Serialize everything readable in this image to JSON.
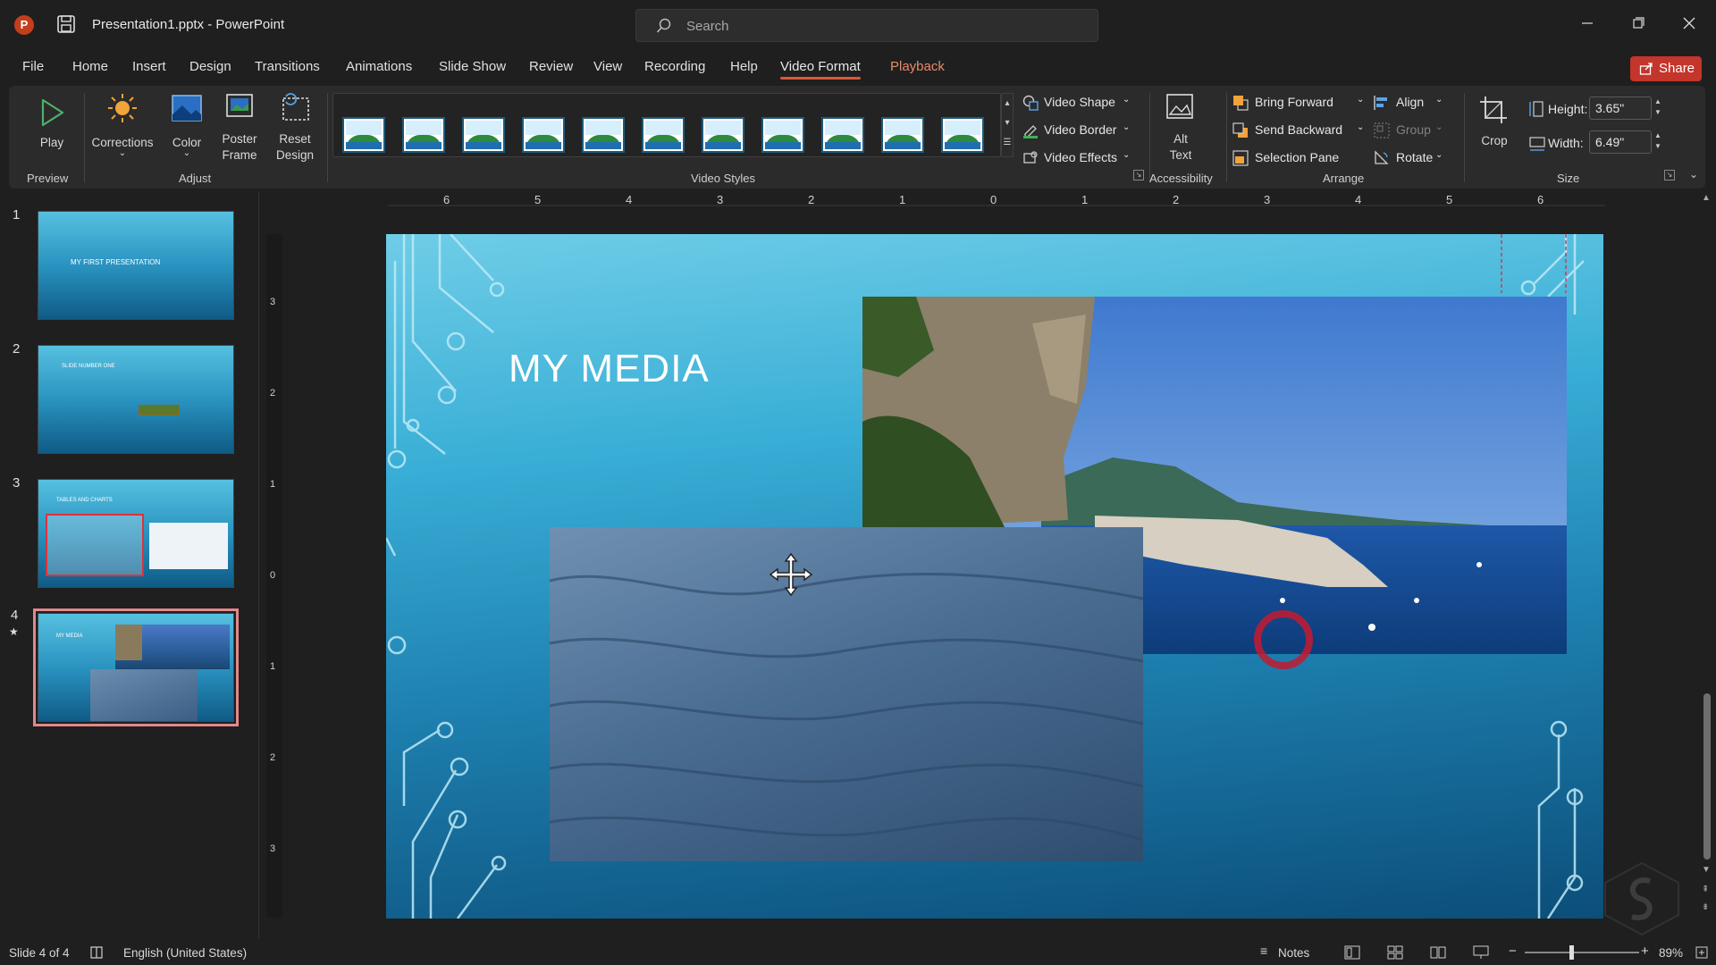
{
  "window": {
    "doc_title": "Presentation1.pptx  -  PowerPoint",
    "app_logo": "P",
    "search_placeholder": "Search"
  },
  "tabs": [
    "File",
    "Home",
    "Insert",
    "Design",
    "Transitions",
    "Animations",
    "Slide Show",
    "Review",
    "View",
    "Recording",
    "Help",
    "Video Format",
    "Playback"
  ],
  "active_tab": "Video Format",
  "share_label": "Share",
  "ribbon": {
    "preview": {
      "play": "Play",
      "group": "Preview"
    },
    "adjust": {
      "corrections": "Corrections",
      "color": "Color",
      "poster1": "Poster",
      "poster2": "Frame",
      "reset1": "Reset",
      "reset2": "Design",
      "group": "Adjust"
    },
    "video_styles": {
      "group": "Video Styles",
      "shape": "Video Shape",
      "border": "Video Border",
      "effects": "Video Effects"
    },
    "accessibility": {
      "alt1": "Alt",
      "alt2": "Text",
      "group": "Accessibility"
    },
    "arrange": {
      "bring_forward": "Bring Forward",
      "send_backward": "Send Backward",
      "selection_pane": "Selection Pane",
      "align": "Align",
      "group_btn": "Group",
      "rotate": "Rotate",
      "group": "Arrange"
    },
    "size": {
      "crop": "Crop",
      "height_label": "Height:",
      "height_value": "3.65\"",
      "width_label": "Width:",
      "width_value": "6.49\"",
      "group": "Size"
    }
  },
  "ruler_numbers": [
    "6",
    "5",
    "4",
    "3",
    "2",
    "1",
    "0",
    "1",
    "2",
    "3",
    "4",
    "5",
    "6"
  ],
  "vruler_numbers": [
    "3",
    "2",
    "1",
    "0",
    "1",
    "2",
    "3"
  ],
  "slides": [
    {
      "num": "1",
      "title": "MY FIRST PRESENTATION"
    },
    {
      "num": "2",
      "title": "SLIDE NUMBER ONE"
    },
    {
      "num": "3",
      "title": "TABLES AND CHARTS"
    },
    {
      "num": "4",
      "title": "MY MEDIA"
    }
  ],
  "slide": {
    "title": "MY MEDIA"
  },
  "status": {
    "slide_info": "Slide 4 of 4",
    "language": "English (United States)",
    "notes": "Notes",
    "zoom": "89%"
  },
  "colors": {
    "accent_tab": "#d65a3a",
    "share": "#c4352b",
    "selected_slide_border": "#e2888b"
  }
}
